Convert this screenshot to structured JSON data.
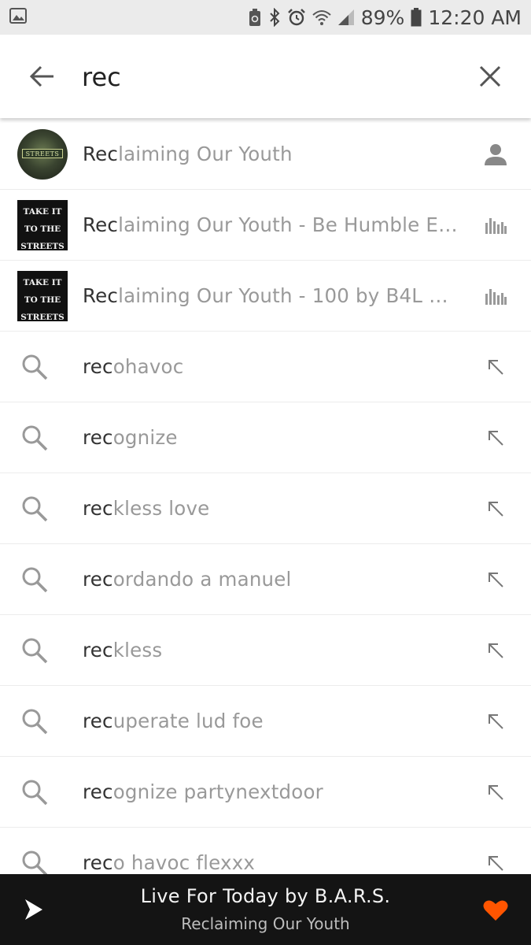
{
  "status_bar": {
    "battery": "89%",
    "time": "12:20 AM",
    "icons": [
      "gallery-icon",
      "recycle-icon",
      "bluetooth-icon",
      "alarm-icon",
      "wifi-icon",
      "signal-icon",
      "battery-icon"
    ]
  },
  "search": {
    "query": "rec",
    "back_icon": "arrow-back-icon",
    "clear_icon": "close-icon"
  },
  "results": [
    {
      "type": "user",
      "match": "Rec",
      "rest": "laiming Our Youth",
      "icon": "person-icon"
    },
    {
      "type": "track",
      "match": "Rec",
      "rest": "laiming Our Youth - Be Humble Ev...",
      "icon": "waveform-icon",
      "artwork_lines": [
        "TAKE IT",
        "TO THE",
        "STREETS"
      ]
    },
    {
      "type": "track",
      "match": "Rec",
      "rest": "laiming Our Youth - 100 by B4L Br...",
      "icon": "waveform-icon",
      "artwork_lines": [
        "TAKE IT",
        "TO THE",
        "STREETS"
      ]
    },
    {
      "type": "suggestion",
      "match": "rec",
      "rest": "ohavoc"
    },
    {
      "type": "suggestion",
      "match": "rec",
      "rest": "ognize"
    },
    {
      "type": "suggestion",
      "match": "rec",
      "rest": "kless love"
    },
    {
      "type": "suggestion",
      "match": "rec",
      "rest": "ordando a manuel"
    },
    {
      "type": "suggestion",
      "match": "rec",
      "rest": "kless"
    },
    {
      "type": "suggestion",
      "match": "rec",
      "rest": "uperate lud foe"
    },
    {
      "type": "suggestion",
      "match": "rec",
      "rest": "ognize partynextdoor"
    },
    {
      "type": "suggestion",
      "match": "rec",
      "rest": "o havoc flexxx"
    }
  ],
  "player": {
    "track": "Live For Today by B.A.R.S.",
    "artist": "Reclaiming Our Youth",
    "accent": "#ff5500"
  }
}
